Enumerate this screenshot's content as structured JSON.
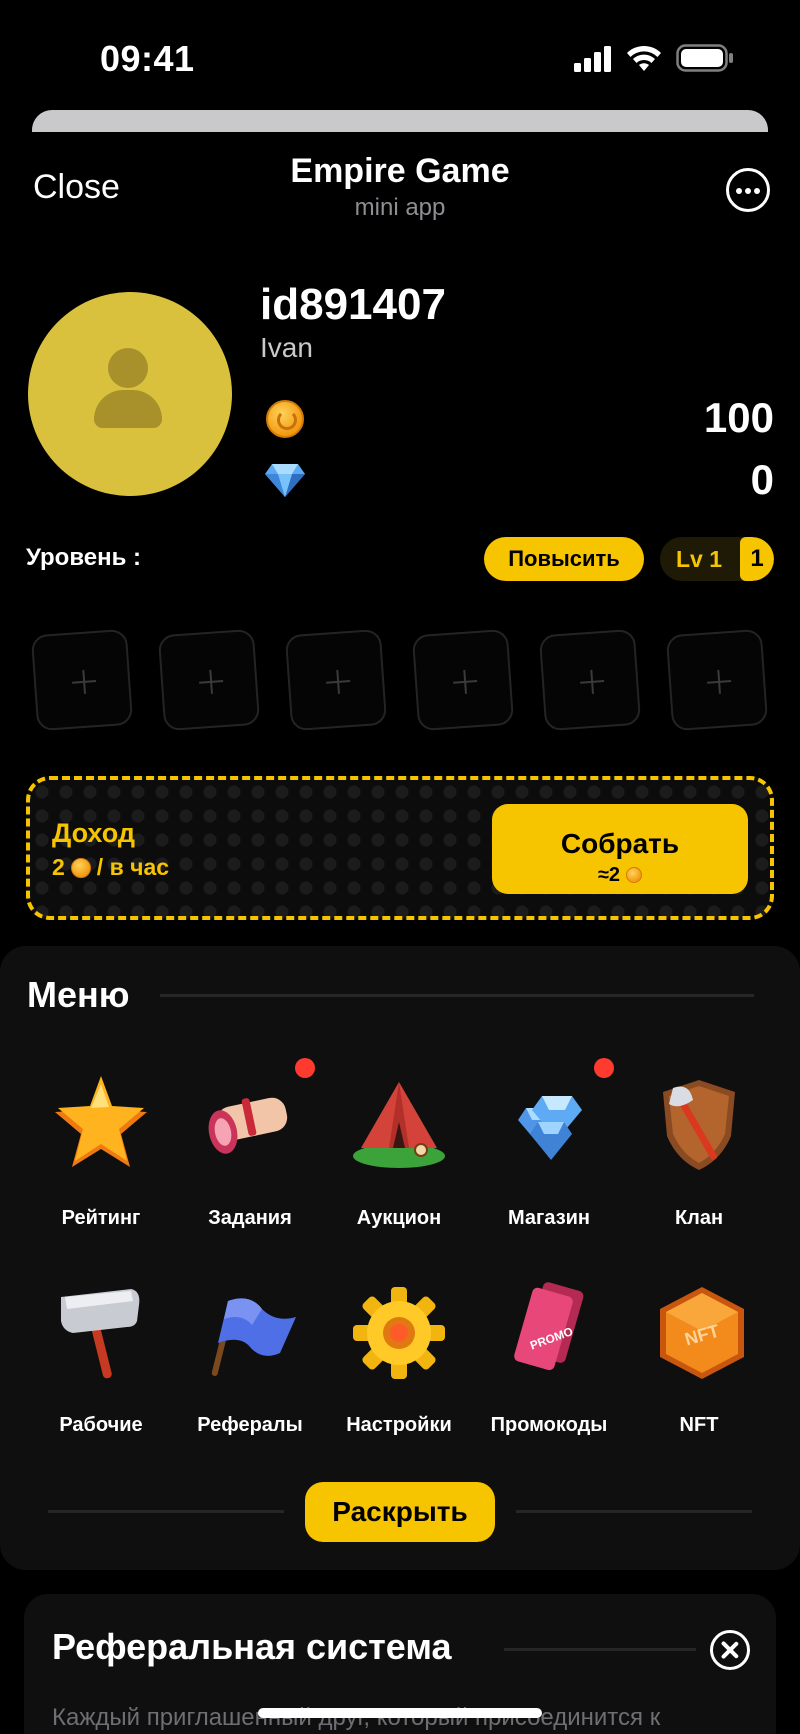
{
  "status_bar": {
    "time": "09:41"
  },
  "header": {
    "close_label": "Close",
    "title": "Empire Game",
    "subtitle": "mini app",
    "more_icon": "more-horizontal-icon"
  },
  "profile": {
    "id": "id891407",
    "name": "Ivan",
    "coins": "100",
    "gems": "0"
  },
  "level": {
    "label": "Уровень :",
    "raise_label": "Повысить",
    "lv_label": "Lv 1",
    "lv_number": "1"
  },
  "slots": {
    "count": 6,
    "icon": "plus-icon"
  },
  "income": {
    "title": "Доход",
    "amount": "2",
    "per_hour": "/ в час",
    "collect_label": "Собрать",
    "collect_amount": "≈2"
  },
  "menu": {
    "title": "Меню",
    "items": [
      {
        "label": "Рейтинг",
        "icon": "star-icon",
        "badge": false
      },
      {
        "label": "Задания",
        "icon": "scroll-icon",
        "badge": true
      },
      {
        "label": "Аукцион",
        "icon": "tent-icon",
        "badge": false
      },
      {
        "label": "Магазин",
        "icon": "diamonds-icon",
        "badge": true
      },
      {
        "label": "Клан",
        "icon": "shield-axe-icon",
        "badge": false
      },
      {
        "label": "Рабочие",
        "icon": "hammer-icon",
        "badge": false
      },
      {
        "label": "Рефералы",
        "icon": "flag-icon",
        "badge": false
      },
      {
        "label": "Настройки",
        "icon": "gear-icon",
        "badge": false
      },
      {
        "label": "Промокоды",
        "icon": "promo-ticket-icon",
        "badge": false
      },
      {
        "label": "NFT",
        "icon": "nft-hexagon-icon",
        "badge": false
      }
    ],
    "promo_ticket_text": "PROMO",
    "nft_badge_text": "NFT",
    "expand_label": "Раскрыть"
  },
  "referral": {
    "title": "Реферальная система",
    "text": "Каждый приглашенный друг, который присоединится к"
  },
  "colors": {
    "accent": "#f7c400",
    "background": "#000000",
    "panel": "#0f0f0f",
    "badge": "#ff3b30",
    "avatar": "#d9c13e"
  }
}
